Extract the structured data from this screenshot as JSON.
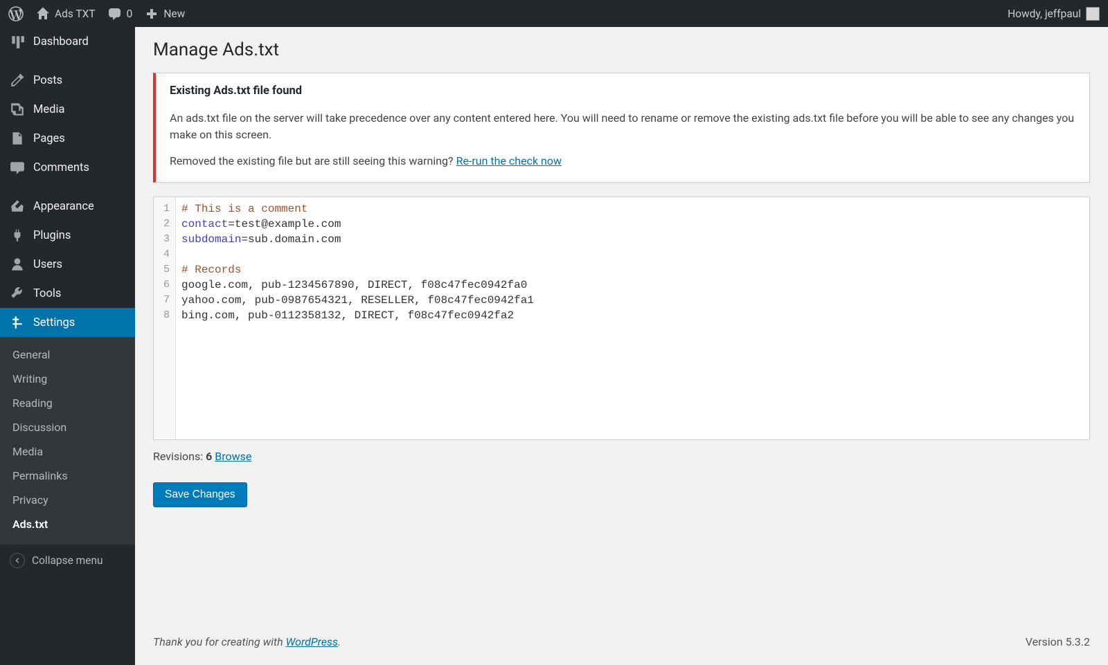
{
  "adminbar": {
    "site_name": "Ads TXT",
    "comment_count": "0",
    "new_label": "New",
    "howdy_prefix": "Howdy, ",
    "user": "jeffpaul"
  },
  "sidebar": {
    "items": [
      {
        "label": "Dashboard",
        "icon": "dashboard"
      },
      {
        "label": "Posts",
        "icon": "posts"
      },
      {
        "label": "Media",
        "icon": "media"
      },
      {
        "label": "Pages",
        "icon": "pages"
      },
      {
        "label": "Comments",
        "icon": "comments"
      },
      {
        "label": "Appearance",
        "icon": "appearance"
      },
      {
        "label": "Plugins",
        "icon": "plugins"
      },
      {
        "label": "Users",
        "icon": "users"
      },
      {
        "label": "Tools",
        "icon": "tools"
      },
      {
        "label": "Settings",
        "icon": "settings",
        "current": true
      }
    ],
    "submenu": [
      {
        "label": "General"
      },
      {
        "label": "Writing"
      },
      {
        "label": "Reading"
      },
      {
        "label": "Discussion"
      },
      {
        "label": "Media"
      },
      {
        "label": "Permalinks"
      },
      {
        "label": "Privacy"
      },
      {
        "label": "Ads.txt",
        "current": true
      }
    ],
    "collapse_label": "Collapse menu"
  },
  "page": {
    "title": "Manage Ads.txt",
    "notice": {
      "title": "Existing Ads.txt file found",
      "body": "An ads.txt file on the server will take precedence over any content entered here. You will need to rename or remove the existing ads.txt file before you will be able to see any changes you make on this screen.",
      "prompt": "Removed the existing file but are still seeing this warning? ",
      "link": "Re-run the check now"
    },
    "editor_lines": [
      [
        {
          "c": "cm-comment",
          "t": "# This is a comment"
        }
      ],
      [
        {
          "c": "cm-keyword",
          "t": "contact"
        },
        {
          "c": "",
          "t": "=test@example.com"
        }
      ],
      [
        {
          "c": "cm-keyword",
          "t": "subdomain"
        },
        {
          "c": "",
          "t": "=sub.domain.com"
        }
      ],
      [
        {
          "c": "",
          "t": ""
        }
      ],
      [
        {
          "c": "cm-comment",
          "t": "# Records"
        }
      ],
      [
        {
          "c": "",
          "t": "google.com, pub-1234567890, DIRECT, f08c47fec0942fa0"
        }
      ],
      [
        {
          "c": "",
          "t": "yahoo.com, pub-0987654321, RESELLER, f08c47fec0942fa1"
        }
      ],
      [
        {
          "c": "",
          "t": "bing.com, pub-0112358132, DIRECT, f08c47fec0942fa2"
        }
      ]
    ],
    "revisions": {
      "label": "Revisions: ",
      "count": "6",
      "browse": "Browse"
    },
    "save_label": "Save Changes"
  },
  "footer": {
    "thanks_prefix": "Thank you for creating with ",
    "thanks_link": "WordPress",
    "thanks_suffix": ".",
    "version": "Version 5.3.2"
  }
}
